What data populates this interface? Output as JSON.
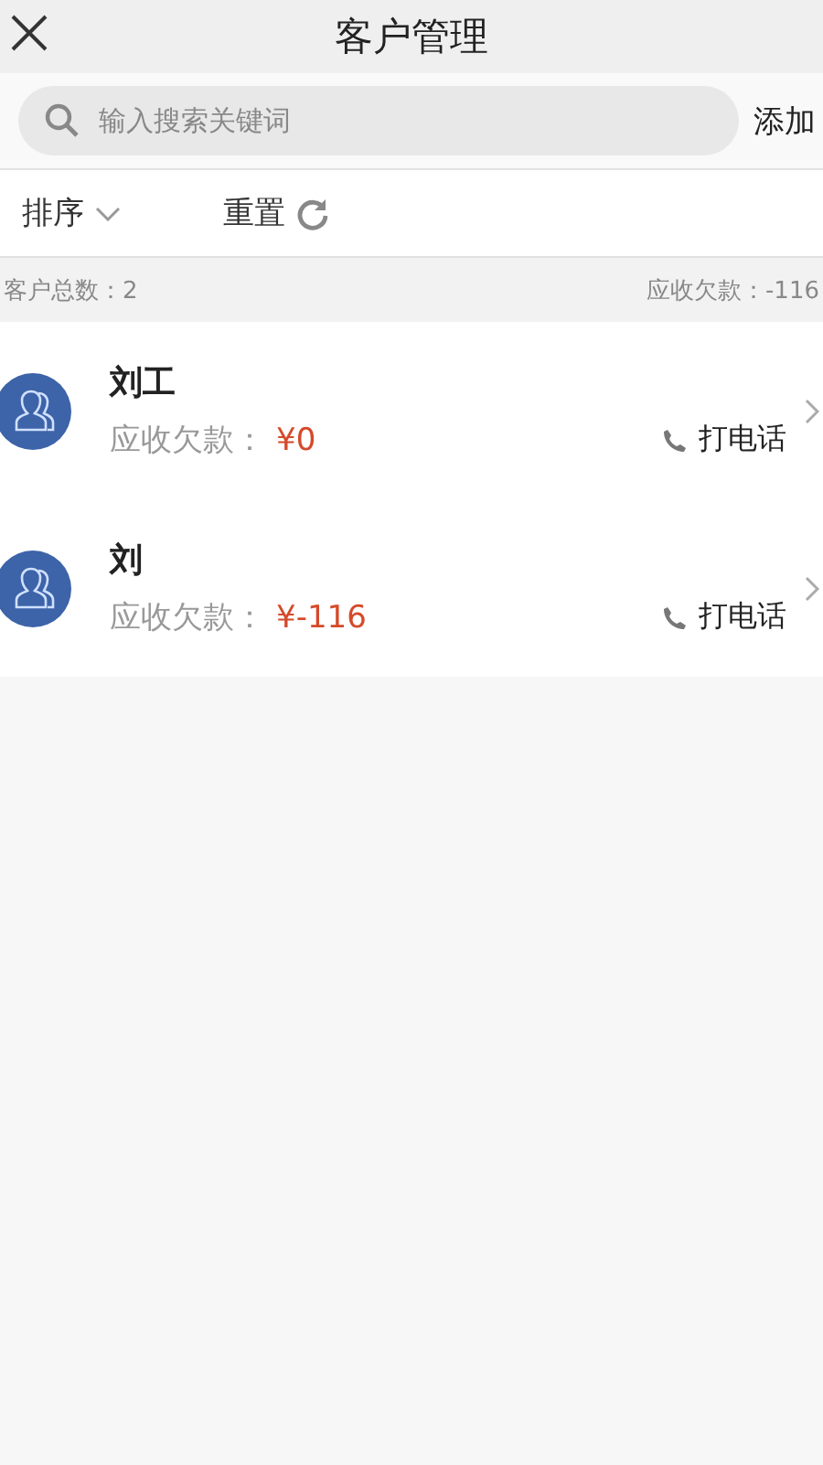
{
  "header": {
    "title": "客户管理"
  },
  "search": {
    "placeholder": "输入搜索关键词",
    "action": "添加"
  },
  "filters": {
    "sort": "排序",
    "reset": "重置"
  },
  "summary": {
    "count": "客户总数：2",
    "receivable": "应收欠款：-116"
  },
  "customers": [
    {
      "name": "刘工",
      "label": "应收欠款：",
      "amount": "¥0",
      "call": "打电话"
    },
    {
      "name": "刘",
      "label": "应收欠款：",
      "amount": "¥-116",
      "call": "打电话"
    }
  ]
}
